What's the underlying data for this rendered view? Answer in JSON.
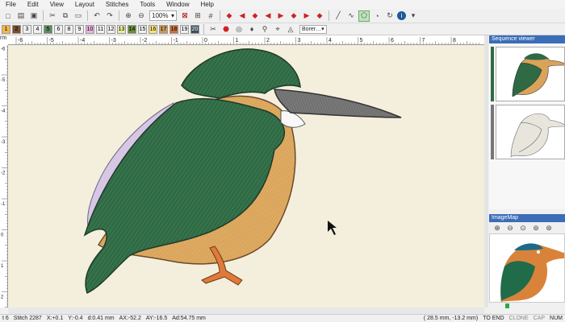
{
  "menu": [
    "File",
    "Edit",
    "View",
    "Layout",
    "Stitches",
    "Tools",
    "Window",
    "Help"
  ],
  "toolbar": {
    "zoom": "100%",
    "zoom_arrow": "▾"
  },
  "palette": {
    "cells": [
      {
        "label": "1",
        "color": "#f2b54a"
      },
      {
        "label": "2",
        "color": "#7b4e2e"
      },
      {
        "label": "3",
        "color": "#f0f0f0"
      },
      {
        "label": "4",
        "color": "#f0f0f0"
      },
      {
        "label": "5",
        "color": "#5a8a5a"
      },
      {
        "label": "6",
        "color": "#f0f0f0"
      },
      {
        "label": "8",
        "color": "#f0f0f0"
      },
      {
        "label": "9",
        "color": "#f0f0f0"
      },
      {
        "label": "10",
        "color": "#e8b3d8"
      },
      {
        "label": "11",
        "color": "#f0f0f0"
      },
      {
        "label": "12",
        "color": "#f0f0f0"
      },
      {
        "label": "13",
        "color": "#e9e9a0"
      },
      {
        "label": "14",
        "color": "#6b8f3b"
      },
      {
        "label": "15",
        "color": "#f0f0f0"
      },
      {
        "label": "16",
        "color": "#f6e27a"
      },
      {
        "label": "17",
        "color": "#c89a5a"
      },
      {
        "label": "18",
        "color": "#c9703a"
      },
      {
        "label": "19",
        "color": "#f0f0f0"
      },
      {
        "label": "20",
        "color": "#3b4f5e"
      }
    ],
    "border_combo": "Borer…"
  },
  "ruler": {
    "corner": "rm",
    "top_labels": [
      "-6",
      "-5",
      "-4",
      "-3",
      "-2",
      "-1",
      "0",
      "1",
      "2",
      "3",
      "4",
      "5",
      "6",
      "7",
      "8"
    ],
    "left_labels": [
      "-7",
      "-6",
      "-5",
      "-4",
      "-3",
      "-2",
      "-1",
      "0",
      "1",
      "2",
      "3"
    ]
  },
  "panels": {
    "sequence_viewer": "Sequence viewer",
    "image_map": "ImageMap"
  },
  "status": {
    "left": "t 6",
    "stitch": "Stitch 2287",
    "x": "X:+0.1",
    "y": "Y:-0.4",
    "d": "d:0.41 mm",
    "ax": "AX:-52.2",
    "ay": "AY:-16.5",
    "ad": "Ad:54.75 mm",
    "coords": "(  28.5 mm,  -13.2 mm)",
    "to_end": "TO END",
    "clone": "CLONE",
    "cap": "CAP",
    "num": "NUM"
  },
  "colors": {
    "canvas": "#f4efdd",
    "bird_green": "#2f6a45",
    "bird_orange": "#d9a35a",
    "bird_lilac": "#d8c6e6",
    "beak": "#6b6b6b",
    "foot": "#e0793a",
    "panel_title": "#3b6db8"
  }
}
